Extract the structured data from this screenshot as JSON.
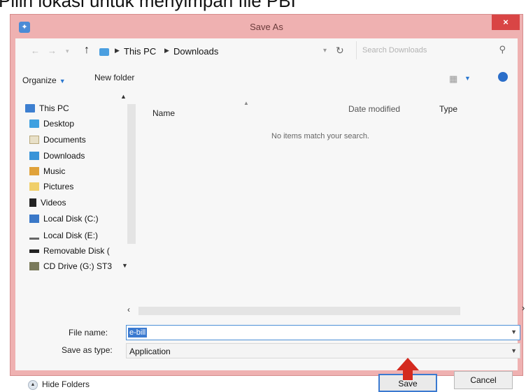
{
  "caption": "Pilih lokasi untuk menyimpan file PBI",
  "window": {
    "title": "Save As",
    "close": "×"
  },
  "address": {
    "crumbs": [
      "This PC",
      "Downloads"
    ],
    "search_placeholder": "Search Downloads"
  },
  "toolbar": {
    "organize": "Organize",
    "new_folder": "New folder"
  },
  "sidebar": {
    "items": [
      "This PC",
      "Desktop",
      "Documents",
      "Downloads",
      "Music",
      "Pictures",
      "Videos",
      "Local Disk (C:)",
      "Local Disk (E:)",
      "Removable Disk (",
      "CD Drive (G:) ST3"
    ]
  },
  "list": {
    "columns": {
      "name": "Name",
      "date_modified": "Date modified",
      "type": "Type"
    },
    "empty_message": "No items match your search."
  },
  "form": {
    "file_name_label": "File name:",
    "file_name_value": "e-bill",
    "save_type_label": "Save as type:",
    "save_type_value": "Application"
  },
  "footer": {
    "hide_folders": "Hide Folders",
    "save": "Save",
    "cancel": "Cancel"
  }
}
